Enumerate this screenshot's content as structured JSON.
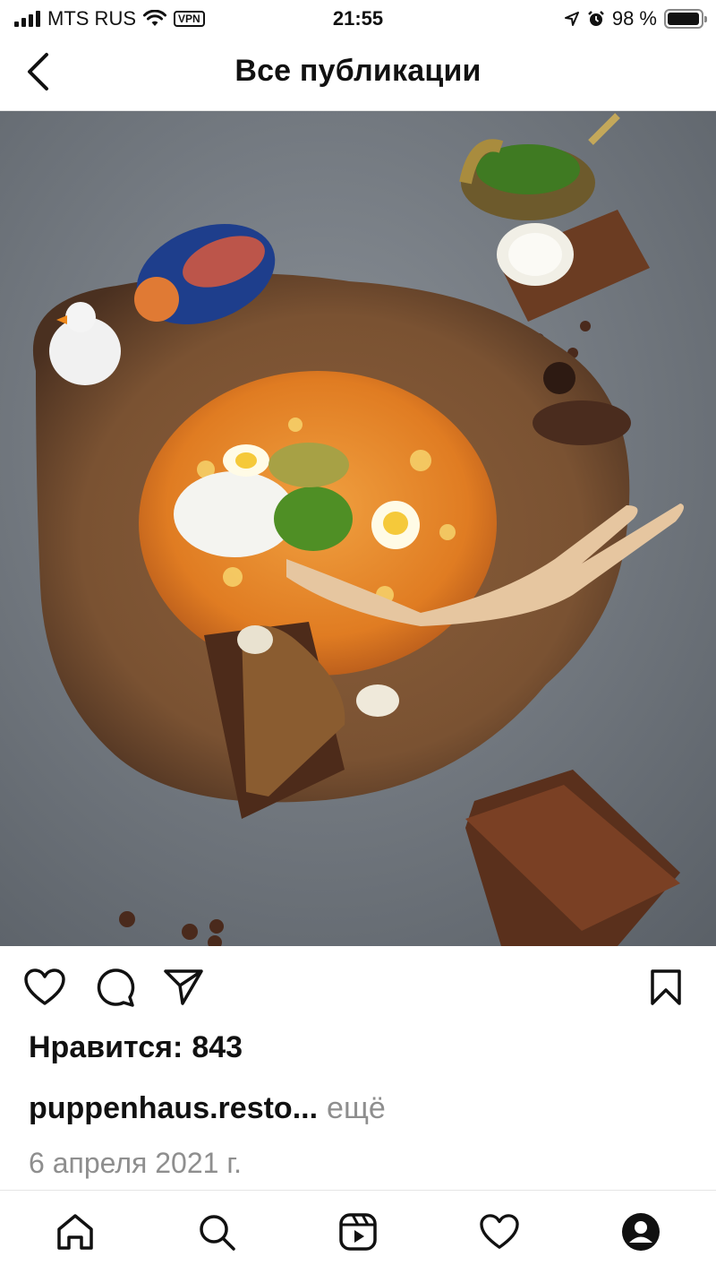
{
  "status_bar": {
    "carrier": "MTS RUS",
    "vpn": "VPN",
    "time": "21:55",
    "battery": "98 %",
    "battery_level": 0.98
  },
  "header": {
    "title": "Все публикации",
    "back_icon": "chevron-left-icon"
  },
  "post": {
    "image_alt": "Солянка в деревянной чаше",
    "actions": {
      "like_icon": "heart-icon",
      "comment_icon": "comment-icon",
      "share_icon": "send-icon",
      "save_icon": "bookmark-icon"
    },
    "likes_label": "Нравится:",
    "likes_count": "843",
    "username": "puppenhaus.resto...",
    "more_label": "ещё",
    "date": "6 апреля 2021 г."
  },
  "bottom_nav": {
    "items": [
      {
        "icon": "home-icon"
      },
      {
        "icon": "search-icon"
      },
      {
        "icon": "reels-icon"
      },
      {
        "icon": "heart-icon"
      },
      {
        "icon": "profile-icon"
      }
    ]
  }
}
